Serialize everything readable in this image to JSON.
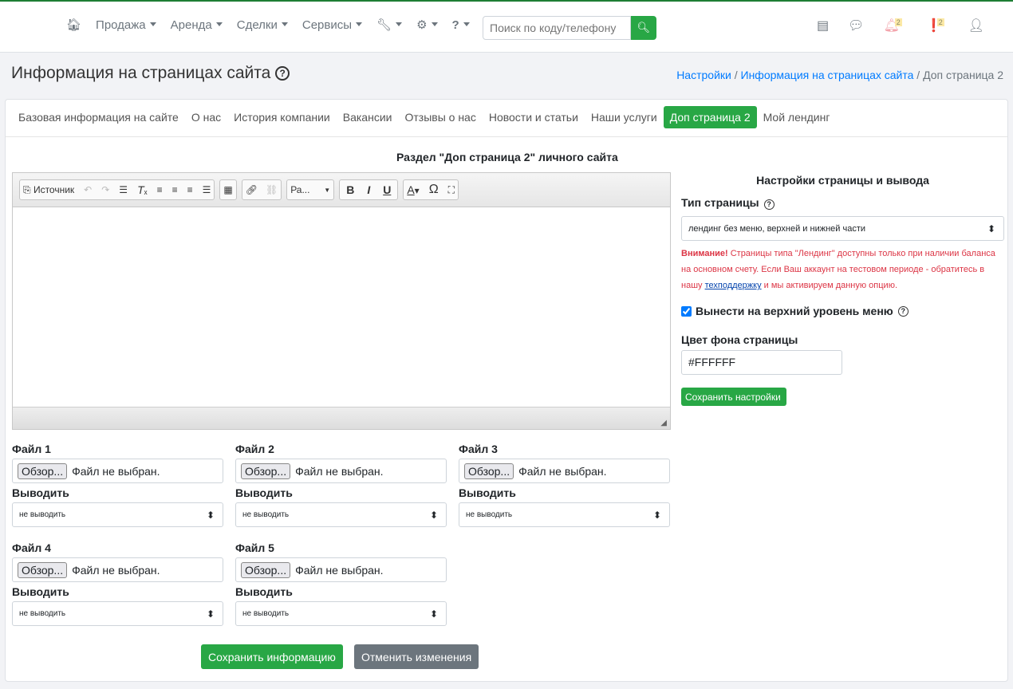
{
  "nav": {
    "items": [
      "Продажа",
      "Аренда",
      "Сделки",
      "Сервисы"
    ],
    "search_placeholder": "Поиск по коду/телефону",
    "notif_count": "2",
    "alert_count": "2"
  },
  "page": {
    "title": "Информация на страницах сайта",
    "breadcrumb": [
      "Настройки",
      "Информация на страницах сайта",
      "Доп страница 2"
    ]
  },
  "tabs": [
    "Базовая информация на сайте",
    "О нас",
    "История компании",
    "Вакансии",
    "Отзывы о нас",
    "Новости и статьи",
    "Наши услуги",
    "Доп страница 2",
    "Мой лендинг"
  ],
  "section_title": "Раздел \"Доп страница 2\" личного сайта",
  "editor": {
    "source": "Источник",
    "format": "Ра..."
  },
  "files": [
    {
      "label": "Файл 1",
      "browse": "Обзор...",
      "status": "Файл не выбран.",
      "output_label": "Выводить",
      "output": "не выводить"
    },
    {
      "label": "Файл 2",
      "browse": "Обзор...",
      "status": "Файл не выбран.",
      "output_label": "Выводить",
      "output": "не выводить"
    },
    {
      "label": "Файл 3",
      "browse": "Обзор...",
      "status": "Файл не выбран.",
      "output_label": "Выводить",
      "output": "не выводить"
    },
    {
      "label": "Файл 4",
      "browse": "Обзор...",
      "status": "Файл не выбран.",
      "output_label": "Выводить",
      "output": "не выводить"
    },
    {
      "label": "Файл 5",
      "browse": "Обзор...",
      "status": "Файл не выбран.",
      "output_label": "Выводить",
      "output": "не выводить"
    }
  ],
  "actions": {
    "save": "Сохранить информацию",
    "cancel": "Отменить изменения"
  },
  "settings": {
    "title": "Настройки страницы и вывода",
    "type_label": "Тип страницы",
    "type_value": "лендинг без меню, верхней и нижней части",
    "warn_strong": "Внимание!",
    "warn_1": " Страницы типа \"Лендинг\" доступны только при наличии баланса на основном счету. Если Ваш аккаунт на тестовом периоде - обратитесь в нашу ",
    "warn_link": "техподдержку",
    "warn_2": " и мы активируем данную опцию.",
    "top_menu_label": "Вынести на верхний уровень меню",
    "bg_label": "Цвет фона страницы",
    "bg_value": "#FFFFFF",
    "save": "Сохранить настройки"
  }
}
